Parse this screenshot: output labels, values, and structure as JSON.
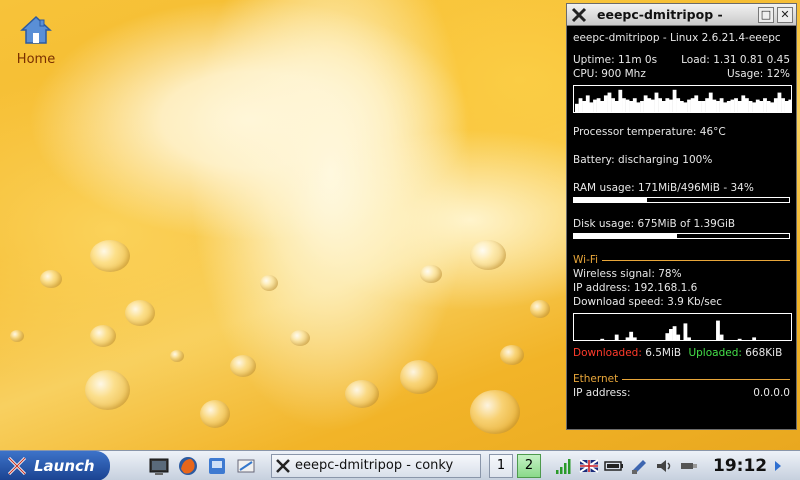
{
  "desktop": {
    "home_label": "Home"
  },
  "conky": {
    "window_title": "eeepc-dmitripop -",
    "header": "eeepc-dmitripop - Linux 2.6.21.4-eeepc",
    "uptime_label": "Uptime:",
    "uptime": "11m 0s",
    "load_label": "Load:",
    "load": "1.31 0.81 0.45",
    "cpu_label": "CPU:",
    "cpu_freq": "900 Mhz",
    "usage_label": "Usage:",
    "cpu_usage": "12%",
    "cpu_history": [
      0.4,
      0.6,
      0.5,
      0.7,
      0.45,
      0.55,
      0.6,
      0.5,
      0.7,
      0.8,
      0.6,
      0.5,
      0.9,
      0.6,
      0.55,
      0.5,
      0.6,
      0.45,
      0.5,
      0.7,
      0.6,
      0.55,
      0.8,
      0.6,
      0.5,
      0.6,
      0.55,
      0.9,
      0.6,
      0.5,
      0.45,
      0.55,
      0.6,
      0.7,
      0.5,
      0.5,
      0.6,
      0.8,
      0.55,
      0.5,
      0.6,
      0.45,
      0.5,
      0.55,
      0.6,
      0.5,
      0.7,
      0.6,
      0.5,
      0.45,
      0.55,
      0.5,
      0.6,
      0.5,
      0.45,
      0.6,
      0.8,
      0.6,
      0.5,
      0.55
    ],
    "temp_label": "Processor temperature:",
    "temp": "46°C",
    "battery_label": "Battery:",
    "battery": "discharging 100%",
    "ram_label": "RAM usage:",
    "ram": "171MiB/496MiB - 34%",
    "ram_fraction": 0.34,
    "disk_label": "Disk usage:",
    "disk": "675MiB of 1.39GiB",
    "disk_fraction": 0.48,
    "wifi_title": "Wi-Fi",
    "wireless_label": "Wireless signal:",
    "wireless": "78%",
    "ip_label": "IP address:",
    "ip": "192.168.1.6",
    "dl_speed_label": "Download speed:",
    "dl_speed": "3.9 Kb/sec",
    "net_history": [
      0.02,
      0.02,
      0.03,
      0.1,
      0.05,
      0.02,
      0.02,
      0.15,
      0.05,
      0.02,
      0.1,
      0.3,
      0.1,
      0.05,
      0.2,
      0.4,
      0.2,
      0.1,
      0.05,
      0.02,
      0.1,
      0.05,
      0.02,
      0.02,
      0.05,
      0.35,
      0.5,
      0.6,
      0.3,
      0.1,
      0.7,
      0.2,
      0.05,
      0.02,
      0.1,
      0.05,
      0.02,
      0.02,
      0.03,
      0.8,
      0.3,
      0.1,
      0.02,
      0.02,
      0.05,
      0.15,
      0.05,
      0.02,
      0.02,
      0.2,
      0.1,
      0.05,
      0.02,
      0.02,
      0.1,
      0.05,
      0.02,
      0.02,
      0.03,
      0.02
    ],
    "downloaded_label": "Downloaded:",
    "downloaded": "6.5MiB",
    "uploaded_label": "Uploaded:",
    "uploaded": "668KiB",
    "ethernet_title": "Ethernet",
    "eth_ip_label": "IP address:",
    "eth_ip": "0.0.0.0",
    "colors": {
      "accent": "#e8a63a",
      "down": "#ff3b2b",
      "up": "#45e04a"
    }
  },
  "taskbar": {
    "launch_label": "Launch",
    "task_label": "eeepc-dmitripop - conky",
    "pager": [
      "1",
      "2"
    ],
    "clock": "19:12",
    "icons": [
      "terminal-icon",
      "firefox-icon",
      "file-manager-icon",
      "settings-icon",
      "wifi-signal-icon",
      "keyboard-layout-icon",
      "battery-icon",
      "network-icon",
      "volume-icon",
      "usb-icon",
      "scroll-right-icon"
    ]
  }
}
